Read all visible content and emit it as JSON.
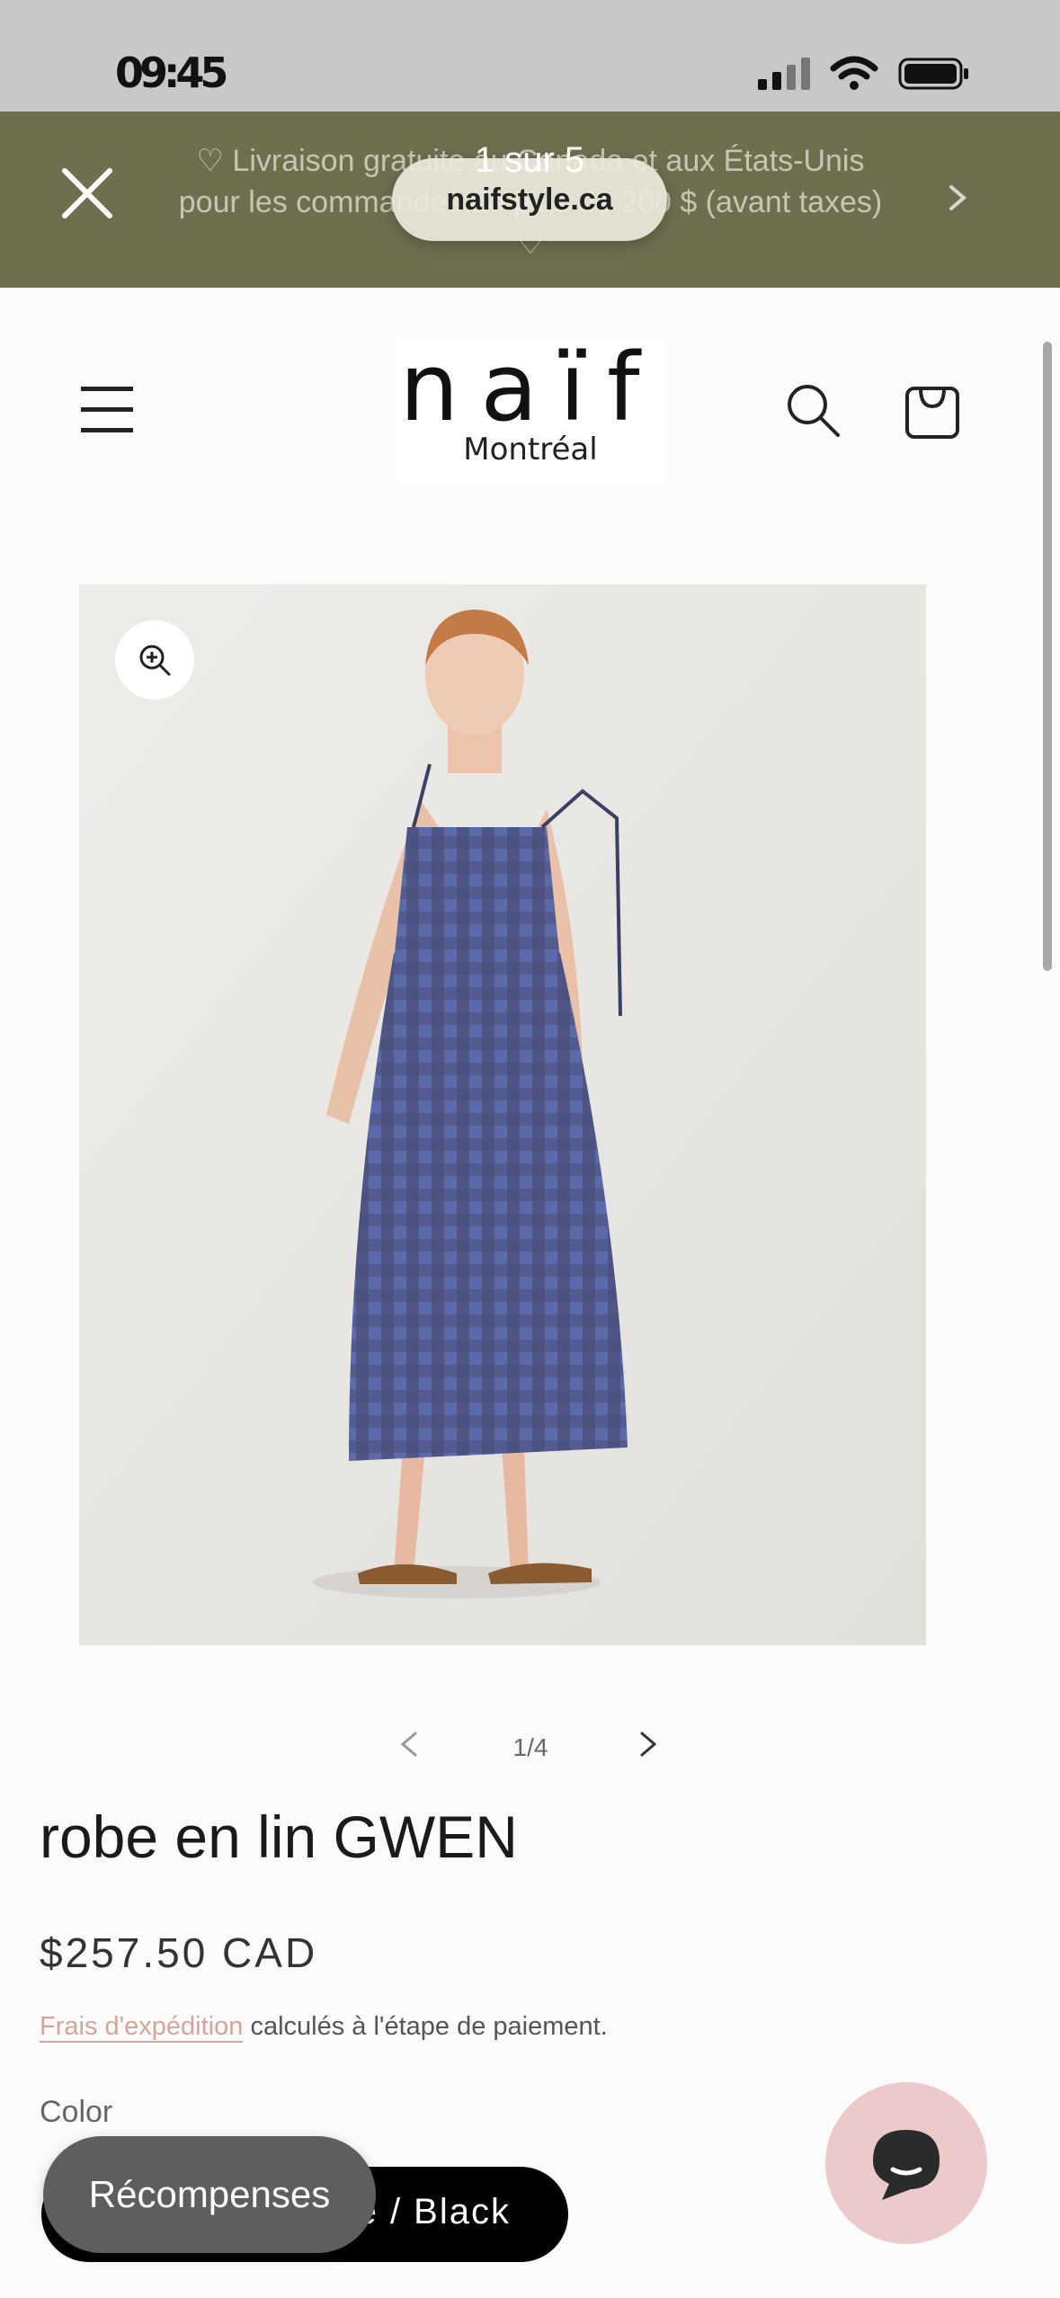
{
  "status_bar": {
    "time": "09:45",
    "battery": "full"
  },
  "announcement": {
    "text": "♡ Livraison gratuite au Canada et aux États-Unis pour les commandes de plus de 200 $ (avant taxes) ♡"
  },
  "browser": {
    "domain": "naifstyle.ca",
    "tab_count": "1 sur 5"
  },
  "brand": {
    "name": "naïf",
    "city": "Montréal"
  },
  "gallery": {
    "counter": "1/4"
  },
  "product": {
    "title": "robe en lin GWEN",
    "price": "$257.50 CAD",
    "shipping_link": "Frais d'expédition",
    "shipping_rest": " calculés à l'étape de paiement.",
    "color_label": "Color",
    "selected_color": "Blue / Black"
  },
  "widgets": {
    "rewards_label": "Récompenses"
  },
  "colors": {
    "announce_bg": "#6f6f50",
    "chat_bg": "#ecc9cb",
    "link": "#d2a79b"
  },
  "icons": [
    "close-icon",
    "chevron-right-icon",
    "menu-icon",
    "search-icon",
    "cart-icon",
    "zoom-in-icon",
    "chevron-left-icon",
    "chat-icon",
    "signal-icon",
    "wifi-icon",
    "battery-icon"
  ]
}
